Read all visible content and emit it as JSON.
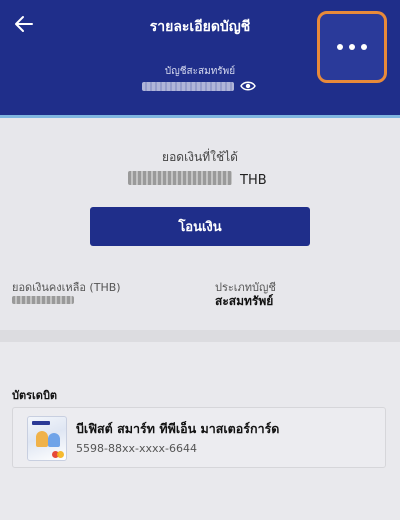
{
  "header": {
    "title": "รายละเอียดบัญชี",
    "account_type_label": "บัญชีสะสมทรัพย์",
    "colors": {
      "background": "#1f2e8a",
      "more_button_border": "#e88a3a"
    }
  },
  "balance": {
    "available_label": "ยอดเงินที่ใช้ได้",
    "currency": "THB",
    "transfer_button": "โอนเงิน",
    "ledger_label": "ยอดเงินคงเหลือ (THB)",
    "account_type_label": "ประเภทบัญชี",
    "account_type_value": "สะสมทรัพย์"
  },
  "debit_cards": {
    "section_title": "บัตรเดบิต",
    "items": [
      {
        "name": "บีเฟิสต์ สมาร์ท ทีพีเอ็น มาสเตอร์การ์ด",
        "number": "5598-88xx-xxxx-6644"
      }
    ]
  },
  "icons": [
    "back-arrow-icon",
    "more-dots-icon",
    "eye-icon",
    "card-thumbnail"
  ]
}
